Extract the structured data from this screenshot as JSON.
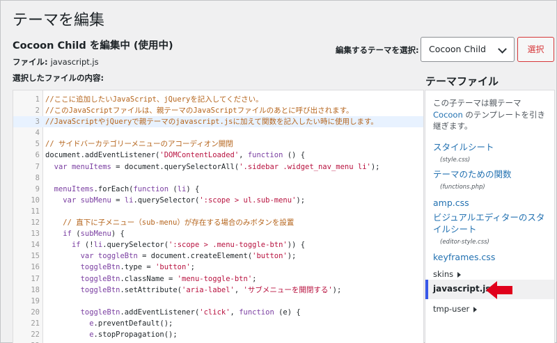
{
  "page": {
    "title": "テーマを編集",
    "edit_heading": "Cocoon Child を編集中 (使用中)",
    "file_label": "ファイル: ",
    "file_name": "javascript.js",
    "selected_contents_label": "選択したファイルの内容:"
  },
  "theme_selector": {
    "label": "編集するテーマを選択:",
    "selected": "Cocoon Child",
    "button_label": "選択"
  },
  "editor": {
    "active_line": 3,
    "lines": [
      {
        "n": "1",
        "seg": [
          {
            "t": "com",
            "v": "//ここに追加したいJavaScript、jQueryを記入してください。"
          }
        ]
      },
      {
        "n": "2",
        "seg": [
          {
            "t": "com",
            "v": "//このJavaScriptファイルは、親テーマのJavaScriptファイルのあとに呼び出されます。"
          }
        ]
      },
      {
        "n": "3",
        "seg": [
          {
            "t": "com",
            "v": "//JavaScriptやjQueryで親テーマのjavascript.jsに加えて関数を記入したい時に使用します。"
          }
        ]
      },
      {
        "n": "4",
        "seg": []
      },
      {
        "n": "5",
        "seg": [
          {
            "t": "com",
            "v": "// サイドバーカテゴリーメニューのアコーディオン開閉"
          }
        ]
      },
      {
        "n": "6",
        "seg": [
          {
            "t": "plain",
            "v": "document.addEventListener("
          },
          {
            "t": "str",
            "v": "'DOMContentLoaded'"
          },
          {
            "t": "plain",
            "v": ", "
          },
          {
            "t": "kw",
            "v": "function"
          },
          {
            "t": "plain",
            "v": " () {"
          }
        ]
      },
      {
        "n": "7",
        "seg": [
          {
            "t": "plain",
            "v": "  "
          },
          {
            "t": "kw",
            "v": "var"
          },
          {
            "t": "plain",
            "v": " "
          },
          {
            "t": "kw",
            "v": "menuItems"
          },
          {
            "t": "plain",
            "v": " = document.querySelectorAll("
          },
          {
            "t": "str",
            "v": "'.sidebar .widget_nav_menu li'"
          },
          {
            "t": "plain",
            "v": ");"
          }
        ]
      },
      {
        "n": "8",
        "seg": []
      },
      {
        "n": "9",
        "seg": [
          {
            "t": "plain",
            "v": "  "
          },
          {
            "t": "kw",
            "v": "menuItems"
          },
          {
            "t": "plain",
            "v": ".forEach("
          },
          {
            "t": "kw",
            "v": "function"
          },
          {
            "t": "plain",
            "v": " ("
          },
          {
            "t": "kw",
            "v": "li"
          },
          {
            "t": "plain",
            "v": ") {"
          }
        ]
      },
      {
        "n": "10",
        "seg": [
          {
            "t": "plain",
            "v": "    "
          },
          {
            "t": "kw",
            "v": "var"
          },
          {
            "t": "plain",
            "v": " "
          },
          {
            "t": "kw",
            "v": "subMenu"
          },
          {
            "t": "plain",
            "v": " = "
          },
          {
            "t": "kw",
            "v": "li"
          },
          {
            "t": "plain",
            "v": ".querySelector("
          },
          {
            "t": "str",
            "v": "':scope > ul.sub-menu'"
          },
          {
            "t": "plain",
            "v": ");"
          }
        ]
      },
      {
        "n": "11",
        "seg": []
      },
      {
        "n": "12",
        "seg": [
          {
            "t": "plain",
            "v": "    "
          },
          {
            "t": "com",
            "v": "// 直下に子メニュー（sub-menu）が存在する場合のみボタンを設置"
          }
        ]
      },
      {
        "n": "13",
        "seg": [
          {
            "t": "plain",
            "v": "    "
          },
          {
            "t": "kw",
            "v": "if"
          },
          {
            "t": "plain",
            "v": " ("
          },
          {
            "t": "kw",
            "v": "subMenu"
          },
          {
            "t": "plain",
            "v": ") {"
          }
        ]
      },
      {
        "n": "14",
        "seg": [
          {
            "t": "plain",
            "v": "      "
          },
          {
            "t": "kw",
            "v": "if"
          },
          {
            "t": "plain",
            "v": " (!"
          },
          {
            "t": "kw",
            "v": "li"
          },
          {
            "t": "plain",
            "v": ".querySelector("
          },
          {
            "t": "str",
            "v": "':scope > .menu-toggle-btn'"
          },
          {
            "t": "plain",
            "v": ")) {"
          }
        ]
      },
      {
        "n": "15",
        "seg": [
          {
            "t": "plain",
            "v": "        "
          },
          {
            "t": "kw",
            "v": "var"
          },
          {
            "t": "plain",
            "v": " "
          },
          {
            "t": "kw",
            "v": "toggleBtn"
          },
          {
            "t": "plain",
            "v": " = document.createElement("
          },
          {
            "t": "str",
            "v": "'button'"
          },
          {
            "t": "plain",
            "v": ");"
          }
        ]
      },
      {
        "n": "16",
        "seg": [
          {
            "t": "plain",
            "v": "        "
          },
          {
            "t": "kw",
            "v": "toggleBtn"
          },
          {
            "t": "plain",
            "v": ".type = "
          },
          {
            "t": "str",
            "v": "'button'"
          },
          {
            "t": "plain",
            "v": ";"
          }
        ]
      },
      {
        "n": "17",
        "seg": [
          {
            "t": "plain",
            "v": "        "
          },
          {
            "t": "kw",
            "v": "toggleBtn"
          },
          {
            "t": "plain",
            "v": ".className = "
          },
          {
            "t": "str",
            "v": "'menu-toggle-btn'"
          },
          {
            "t": "plain",
            "v": ";"
          }
        ]
      },
      {
        "n": "18",
        "seg": [
          {
            "t": "plain",
            "v": "        "
          },
          {
            "t": "kw",
            "v": "toggleBtn"
          },
          {
            "t": "plain",
            "v": ".setAttribute("
          },
          {
            "t": "str",
            "v": "'aria-label'"
          },
          {
            "t": "plain",
            "v": ", "
          },
          {
            "t": "str",
            "v": "'サブメニューを開閉する'"
          },
          {
            "t": "plain",
            "v": ");"
          }
        ]
      },
      {
        "n": "19",
        "seg": []
      },
      {
        "n": "20",
        "seg": [
          {
            "t": "plain",
            "v": "        "
          },
          {
            "t": "kw",
            "v": "toggleBtn"
          },
          {
            "t": "plain",
            "v": ".addEventListener("
          },
          {
            "t": "str",
            "v": "'click'"
          },
          {
            "t": "plain",
            "v": ", "
          },
          {
            "t": "kw",
            "v": "function"
          },
          {
            "t": "plain",
            "v": " (e) {"
          }
        ]
      },
      {
        "n": "21",
        "seg": [
          {
            "t": "plain",
            "v": "          "
          },
          {
            "t": "kw",
            "v": "e"
          },
          {
            "t": "plain",
            "v": ".preventDefault();"
          }
        ]
      },
      {
        "n": "22",
        "seg": [
          {
            "t": "plain",
            "v": "          "
          },
          {
            "t": "kw",
            "v": "e"
          },
          {
            "t": "plain",
            "v": ".stopPropagation();"
          }
        ]
      },
      {
        "n": "23",
        "seg": []
      }
    ]
  },
  "sidebar": {
    "title": "テーマファイル",
    "note_pre": "この子テーマは親テーマ ",
    "note_link": "Cocoon",
    "note_post": " のテンプレートを引き継ぎます。",
    "items": [
      {
        "label": "スタイルシート",
        "sub": "(style.css)"
      },
      {
        "label": "テーマのための関数",
        "sub": "(functions.php)"
      },
      {
        "label": "amp.css"
      },
      {
        "label": "ビジュアルエディターのスタイルシート",
        "sub": "(editor-style.css)"
      },
      {
        "label": "keyframes.css"
      },
      {
        "label": "skins"
      },
      {
        "label": "javascript.js"
      },
      {
        "label": "tmp-user"
      }
    ]
  },
  "colors": {
    "link": "#2271b1",
    "comment": "#b5651d",
    "keyword": "#7a3ea1",
    "string": "#b8123f",
    "danger": "#d63638",
    "active_accent": "#3858e9",
    "arrow": "#e0001b"
  },
  "icons": {
    "select_chevron": "chevron-down-icon",
    "folder_toggle": "triangle-right-icon",
    "annotation": "red-arrow-left-icon"
  }
}
